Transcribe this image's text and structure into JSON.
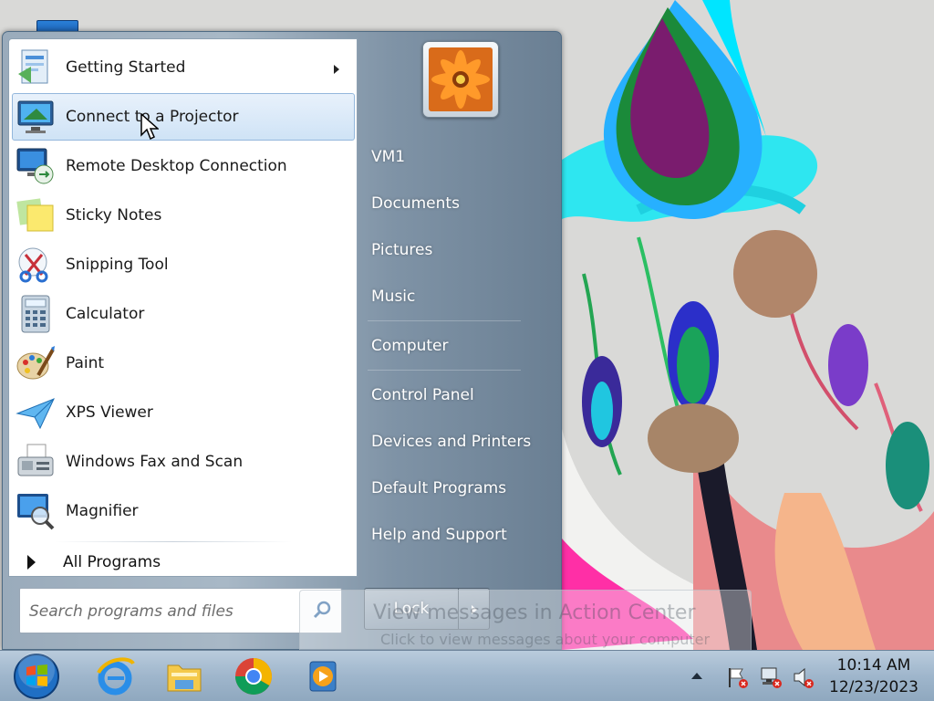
{
  "start_menu": {
    "programs": [
      {
        "label": "Getting Started",
        "icon": "getting-started-icon",
        "has_submenu": true
      },
      {
        "label": "Connect to a Projector",
        "icon": "projector-icon",
        "highlighted": true
      },
      {
        "label": "Remote Desktop Connection",
        "icon": "remote-desktop-icon"
      },
      {
        "label": "Sticky Notes",
        "icon": "sticky-notes-icon"
      },
      {
        "label": "Snipping Tool",
        "icon": "snipping-tool-icon"
      },
      {
        "label": "Calculator",
        "icon": "calculator-icon"
      },
      {
        "label": "Paint",
        "icon": "paint-icon"
      },
      {
        "label": "XPS Viewer",
        "icon": "xps-viewer-icon"
      },
      {
        "label": "Windows Fax and Scan",
        "icon": "fax-scan-icon"
      },
      {
        "label": "Magnifier",
        "icon": "magnifier-icon"
      }
    ],
    "all_programs_label": "All Programs",
    "search_placeholder": "Search programs and files",
    "right_items": [
      {
        "label": "VM1"
      },
      {
        "label": "Documents"
      },
      {
        "label": "Pictures"
      },
      {
        "label": "Music"
      },
      {
        "label": "Computer"
      },
      {
        "label": "Control Panel"
      },
      {
        "label": "Devices and Printers"
      },
      {
        "label": "Default Programs"
      },
      {
        "label": "Help and Support"
      }
    ],
    "lock_label": "Lock"
  },
  "balloon": {
    "title": "View messages in Action Center",
    "body": "Click to view messages about your computer"
  },
  "taskbar": {
    "pinned": [
      {
        "icon": "internet-explorer-icon"
      },
      {
        "icon": "file-explorer-icon"
      },
      {
        "icon": "chrome-icon"
      },
      {
        "icon": "media-player-icon"
      }
    ]
  },
  "clock": {
    "time": "10:14 AM",
    "date": "12/23/2023"
  },
  "colors": {
    "highlight": "#cfe3f6",
    "taskbar": "#9fb6cc",
    "start_orb": "#1f6fc4"
  }
}
